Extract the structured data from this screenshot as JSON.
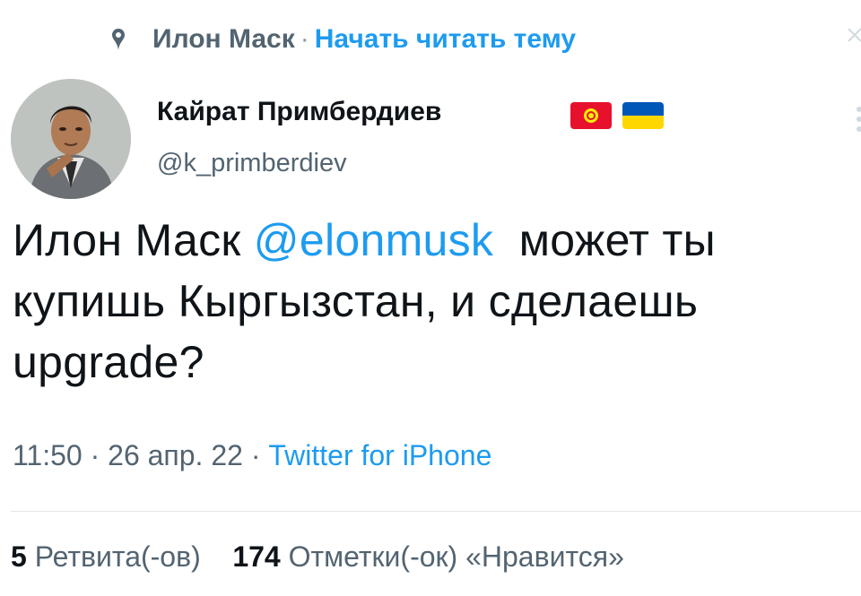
{
  "topic": {
    "pin_icon": "topic-pin-icon",
    "name": "Илон Маск",
    "separator": "·",
    "follow_link": "Начать читать тему"
  },
  "author": {
    "display_name": "Кайрат Примбердиев",
    "handle": "@k_primberdiev",
    "flags": [
      "kyrgyzstan-flag-icon",
      "ukraine-flag-icon"
    ]
  },
  "tweet": {
    "text_before": "Илон Маск ",
    "mention": "@elonmusk",
    "text_after": "  может ты купишь Кыргызстан, и сделаешь upgrade?"
  },
  "meta": {
    "time": "11:50",
    "sep1": " · ",
    "date": "26 апр. 22",
    "sep2": " · ",
    "source": "Twitter for iPhone"
  },
  "stats": {
    "retweets_count": "5",
    "retweets_label": "Ретвита(-ов)",
    "likes_count": "174",
    "likes_label": "Отметки(-ок) «Нравится»"
  },
  "colors": {
    "accent": "#1d9bf0",
    "secondary_text": "#536471",
    "primary_text": "#0f1419"
  }
}
